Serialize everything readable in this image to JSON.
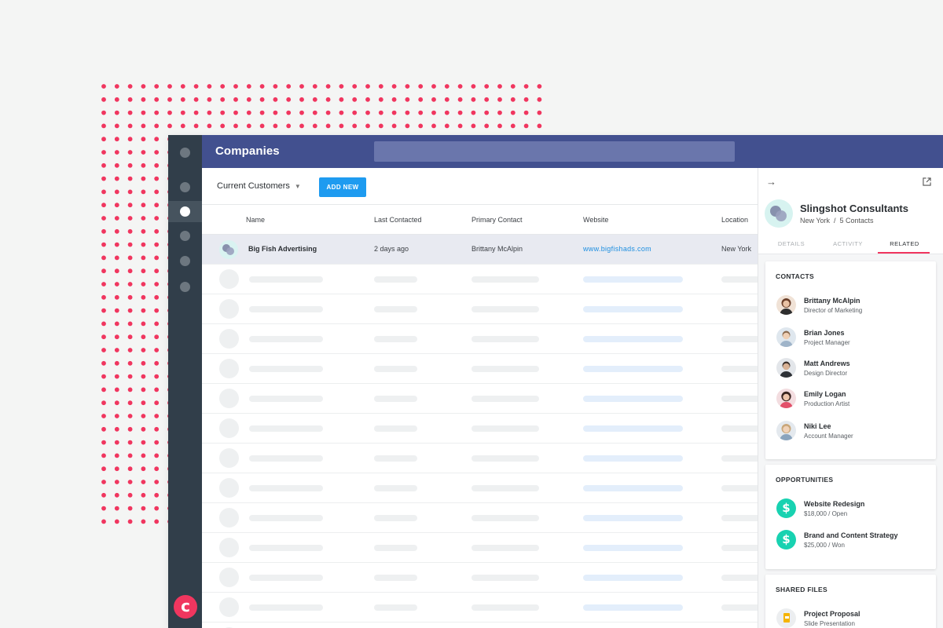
{
  "app": {
    "title": "Companies",
    "brand_color": "#42508f",
    "accent_color": "#f0365f"
  },
  "toolbar": {
    "filter_label": "Current Customers",
    "add_button_label": "ADD NEW"
  },
  "table": {
    "columns": [
      "Name",
      "Last Contacted",
      "Primary Contact",
      "Website",
      "Location"
    ],
    "rows": [
      {
        "name": "Big Fish Advertising",
        "last_contacted": "2 days ago",
        "primary_contact": "Brittany McAlpin",
        "website": "www.bigfishads.com",
        "location": "New York"
      }
    ],
    "placeholder_row_count": 13
  },
  "panel": {
    "company_name": "Slingshot Consultants",
    "subtitle": "New York  /  5 Contacts",
    "tabs": [
      {
        "label": "DETAILS",
        "active": false
      },
      {
        "label": "ACTIVITY",
        "active": false
      },
      {
        "label": "RELATED",
        "active": true
      }
    ],
    "contacts": {
      "title": "CONTACTS",
      "items": [
        {
          "name": "Brittany McAlpin",
          "role": "Director of Marketing"
        },
        {
          "name": "Brian Jones",
          "role": "Project Manager"
        },
        {
          "name": "Matt Andrews",
          "role": "Design Director"
        },
        {
          "name": "Emily Logan",
          "role": "Production Artist"
        },
        {
          "name": "Niki Lee",
          "role": "Account Manager"
        }
      ]
    },
    "opportunities": {
      "title": "OPPORTUNITIES",
      "items": [
        {
          "name": "Website Redesign",
          "detail": "$18,000 / Open",
          "icon": "dollar-icon"
        },
        {
          "name": "Brand and Content Strategy",
          "detail": "$25,000 / Won",
          "icon": "dollar-icon"
        }
      ]
    },
    "shared_files": {
      "title": "SHARED FILES",
      "items": [
        {
          "name": "Project Proposal",
          "detail": "Slide Presentation",
          "icon": "slides-file-icon"
        }
      ]
    }
  }
}
